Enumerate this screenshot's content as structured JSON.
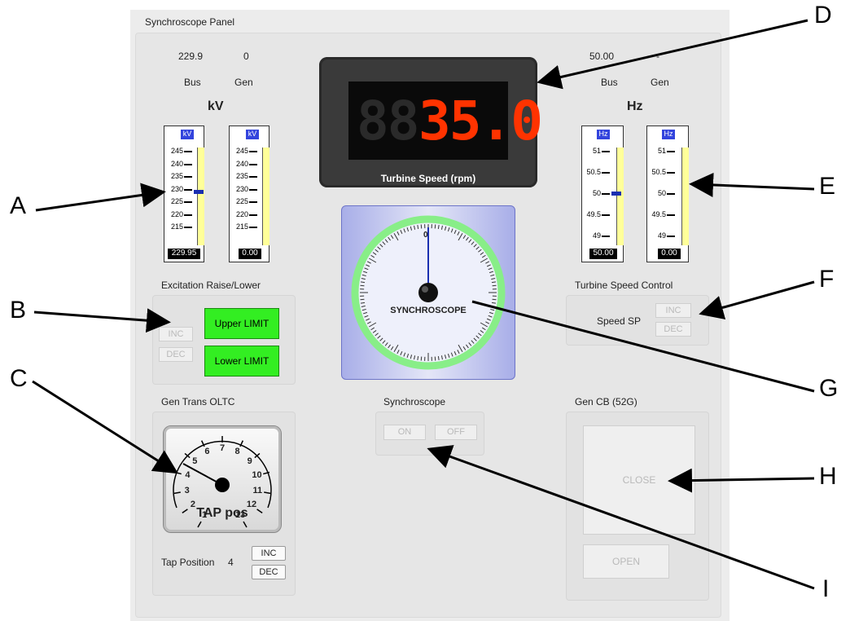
{
  "panel_title": "Synchroscope Panel",
  "kv": {
    "bus_value": "229.9",
    "gen_value": "0",
    "bus_label": "Bus",
    "gen_label": "Gen",
    "unit_heading": "kV",
    "meter_unit": "kV",
    "ticks": [
      "245",
      "240",
      "235",
      "230",
      "225",
      "220",
      "215"
    ],
    "bus_reading": "229.95",
    "gen_reading": "0.00",
    "bus_level": 229.95,
    "gen_level": 0
  },
  "hz": {
    "bus_value": "50.00",
    "gen_value": "-",
    "bus_label": "Bus",
    "gen_label": "Gen",
    "unit_heading": "Hz",
    "meter_unit": "Hz",
    "ticks": [
      "51",
      "50.5",
      "50",
      "49.5",
      "49"
    ],
    "bus_reading": "50.00",
    "gen_reading": "0.00",
    "bus_level": 50.0,
    "gen_level": 0
  },
  "turbine_display": {
    "digits": "35.0",
    "ghost_digits": "88",
    "label": "Turbine Speed (rpm)",
    "digit_color": "#ff3300"
  },
  "synchroscope_dial": {
    "label": "SYNCHROSCOPE",
    "zero_label": "0",
    "ring_color": "#88ee88"
  },
  "excitation": {
    "title": "Excitation Raise/Lower",
    "inc": "INC",
    "dec": "DEC",
    "upper_limit": "Upper LIMIT",
    "lower_limit": "Lower LIMIT",
    "limit_color": "#33ee22"
  },
  "turbine_speed_control": {
    "title": "Turbine Speed Control",
    "sp_label": "Speed SP",
    "inc": "INC",
    "dec": "DEC"
  },
  "oltc": {
    "title": "Gen Trans OLTC",
    "gauge_label": "TAP pos",
    "scale": [
      "1",
      "2",
      "3",
      "4",
      "5",
      "6",
      "7",
      "8",
      "9",
      "10",
      "11",
      "12",
      "13"
    ],
    "tap_label": "Tap Position",
    "tap_value": "4",
    "inc": "INC",
    "dec": "DEC"
  },
  "synchroscope_control": {
    "title": "Synchroscope",
    "on": "ON",
    "off": "OFF"
  },
  "gen_cb": {
    "title": "Gen CB (52G)",
    "close": "CLOSE",
    "open": "OPEN"
  },
  "callouts": [
    "A",
    "B",
    "C",
    "D",
    "E",
    "F",
    "G",
    "H",
    "I"
  ]
}
